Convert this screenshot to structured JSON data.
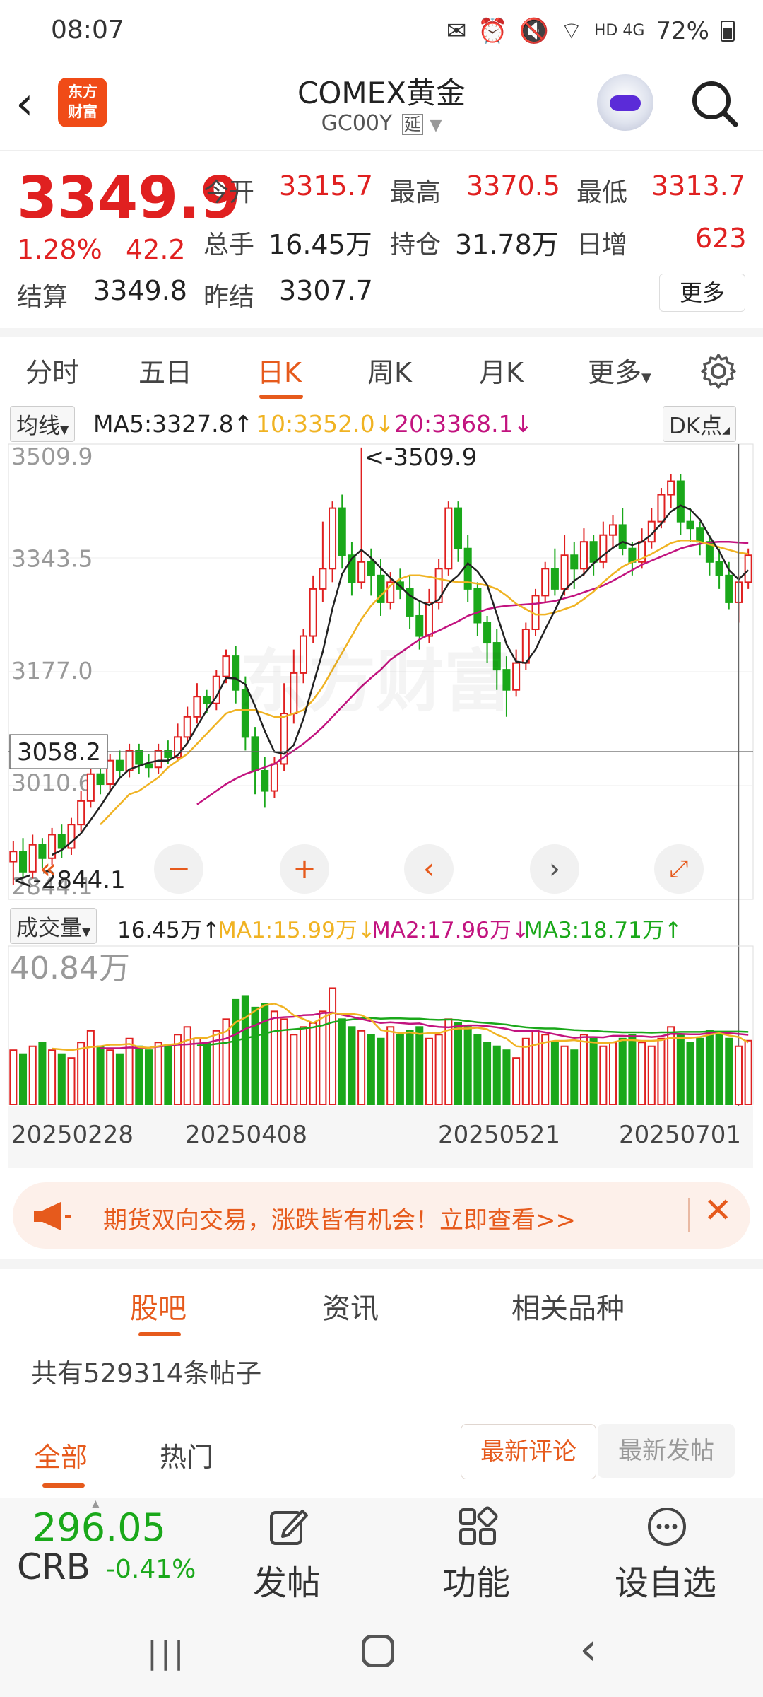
{
  "status_bar": {
    "time": "08:07",
    "icons": "signal-icons",
    "network": "HD 4G",
    "battery": "72%"
  },
  "header": {
    "logo_text": "东方\n财富",
    "title": "COMEX黄金",
    "code": "GC00Y",
    "delay_badge": "延"
  },
  "quote": {
    "price": "3349.9",
    "change_pct": "1.28%",
    "change_val": "42.2",
    "fields": [
      {
        "label": "今开",
        "value": "3315.7"
      },
      {
        "label": "最高",
        "value": "3370.5"
      },
      {
        "label": "最低",
        "value": "3313.7"
      },
      {
        "label": "总手",
        "value": "16.45万"
      },
      {
        "label": "持仓",
        "value": "31.78万"
      },
      {
        "label": "日增",
        "value": "623"
      },
      {
        "label": "结算",
        "value": "3349.8"
      },
      {
        "label": "昨结",
        "value": "3307.7"
      }
    ],
    "more_label": "更多"
  },
  "tabs": [
    "分时",
    "五日",
    "日K",
    "周K",
    "月K",
    "更多"
  ],
  "chart": {
    "ma_button": "均线",
    "ma5": "MA5:3327.8",
    "ma10": "10:3352.0",
    "ma20": "20:3368.1",
    "dk_button": "DK点",
    "y_labels": [
      "3509.9",
      "3343.5",
      "3177.0",
      "3010.6",
      "2844.1"
    ],
    "cursor_label": "3058.2",
    "high_label": "<-3509.9",
    "low_label": "<-2844.1",
    "watermark": "东方财富",
    "vol_button": "成交量",
    "vol_value": "16.45万",
    "vol_ma1": "MA1:15.99万",
    "vol_ma2": "MA2:17.96万",
    "vol_ma3": "MA3:18.71万",
    "vol_max": "40.84万",
    "x_labels": [
      "20250228",
      "20250408",
      "20250521",
      "20250701"
    ],
    "colors": {
      "up": "#e02020",
      "down": "#1aa81a",
      "ma5": "#222222",
      "ma10": "#f0b323",
      "ma20": "#c2137f",
      "vol_ma3": "#1aa81a"
    }
  },
  "chart_data": {
    "type": "candlestick",
    "title": "COMEX黄金 日K",
    "y_range": [
      2844.1,
      3509.9
    ],
    "candles": [
      [
        2895,
        2910,
        2860,
        2925
      ],
      [
        2910,
        2880,
        2870,
        2930
      ],
      [
        2880,
        2920,
        2870,
        2935
      ],
      [
        2920,
        2900,
        2885,
        2930
      ],
      [
        2900,
        2935,
        2890,
        2945
      ],
      [
        2935,
        2915,
        2900,
        2950
      ],
      [
        2915,
        2950,
        2905,
        2960
      ],
      [
        2950,
        2985,
        2940,
        3000
      ],
      [
        2985,
        3025,
        2975,
        3035
      ],
      [
        3025,
        3010,
        2995,
        3045
      ],
      [
        3010,
        3045,
        3000,
        3055
      ],
      [
        3045,
        3030,
        3020,
        3060
      ],
      [
        3030,
        3060,
        3020,
        3070
      ],
      [
        3060,
        3040,
        3025,
        3070
      ],
      [
        3040,
        3035,
        3020,
        3055
      ],
      [
        3035,
        3060,
        3025,
        3070
      ],
      [
        3060,
        3050,
        3040,
        3075
      ],
      [
        3050,
        3080,
        3045,
        3100
      ],
      [
        3080,
        3110,
        3070,
        3125
      ],
      [
        3110,
        3140,
        3100,
        3160
      ],
      [
        3140,
        3130,
        3115,
        3150
      ],
      [
        3130,
        3170,
        3120,
        3180
      ],
      [
        3170,
        3200,
        3160,
        3210
      ],
      [
        3200,
        3150,
        3130,
        3215
      ],
      [
        3150,
        3080,
        3060,
        3170
      ],
      [
        3080,
        3030,
        2995,
        3095
      ],
      [
        3030,
        3000,
        2975,
        3050
      ],
      [
        3000,
        3040,
        2990,
        3050
      ],
      [
        3040,
        3115,
        3030,
        3160
      ],
      [
        3115,
        3175,
        3100,
        3210
      ],
      [
        3175,
        3230,
        3160,
        3240
      ],
      [
        3230,
        3300,
        3220,
        3320
      ],
      [
        3300,
        3330,
        3280,
        3400
      ],
      [
        3330,
        3420,
        3310,
        3430
      ],
      [
        3420,
        3350,
        3330,
        3440
      ],
      [
        3350,
        3310,
        3290,
        3370
      ],
      [
        3310,
        3340,
        3300,
        3510
      ],
      [
        3340,
        3320,
        3290,
        3360
      ],
      [
        3320,
        3280,
        3260,
        3345
      ],
      [
        3280,
        3310,
        3270,
        3325
      ],
      [
        3310,
        3300,
        3285,
        3330
      ],
      [
        3300,
        3260,
        3240,
        3320
      ],
      [
        3260,
        3230,
        3210,
        3280
      ],
      [
        3230,
        3280,
        3220,
        3300
      ],
      [
        3280,
        3330,
        3270,
        3345
      ],
      [
        3330,
        3420,
        3320,
        3430
      ],
      [
        3420,
        3360,
        3340,
        3430
      ],
      [
        3360,
        3300,
        3280,
        3380
      ],
      [
        3300,
        3250,
        3230,
        3310
      ],
      [
        3250,
        3220,
        3190,
        3260
      ],
      [
        3220,
        3180,
        3150,
        3240
      ],
      [
        3180,
        3150,
        3110,
        3200
      ],
      [
        3150,
        3190,
        3140,
        3210
      ],
      [
        3190,
        3240,
        3180,
        3250
      ],
      [
        3240,
        3290,
        3230,
        3300
      ],
      [
        3290,
        3330,
        3280,
        3340
      ],
      [
        3330,
        3300,
        3290,
        3360
      ],
      [
        3300,
        3350,
        3290,
        3380
      ],
      [
        3350,
        3330,
        3300,
        3370
      ],
      [
        3330,
        3370,
        3320,
        3390
      ],
      [
        3370,
        3340,
        3320,
        3380
      ],
      [
        3340,
        3380,
        3330,
        3400
      ],
      [
        3380,
        3395,
        3360,
        3410
      ],
      [
        3395,
        3360,
        3350,
        3420
      ],
      [
        3360,
        3340,
        3320,
        3370
      ],
      [
        3340,
        3370,
        3330,
        3390
      ],
      [
        3370,
        3400,
        3360,
        3420
      ],
      [
        3400,
        3440,
        3390,
        3450
      ],
      [
        3440,
        3460,
        3420,
        3470
      ],
      [
        3460,
        3400,
        3380,
        3470
      ],
      [
        3400,
        3390,
        3370,
        3420
      ],
      [
        3390,
        3370,
        3350,
        3400
      ],
      [
        3370,
        3340,
        3320,
        3380
      ],
      [
        3340,
        3320,
        3300,
        3360
      ],
      [
        3320,
        3280,
        3270,
        3340
      ],
      [
        3280,
        3310,
        3250,
        3320
      ],
      [
        3310,
        3350,
        3300,
        3360
      ]
    ],
    "ma5": [
      null,
      null,
      null,
      null,
      2905,
      2912,
      2924,
      2937,
      2957,
      2977,
      2999,
      3019,
      3032,
      3037,
      3042,
      3045,
      3045,
      3053,
      3071,
      3096,
      3120,
      3140,
      3168,
      3167,
      3158,
      3126,
      3089,
      3058,
      3055,
      3068,
      3107,
      3158,
      3207,
      3271,
      3322,
      3345,
      3358,
      3346,
      3331,
      3316,
      3304,
      3290,
      3282,
      3276,
      3284,
      3308,
      3320,
      3338,
      3326,
      3306,
      3262,
      3218,
      3192,
      3190,
      3210,
      3240,
      3268,
      3298,
      3312,
      3322,
      3338,
      3350,
      3361,
      3370,
      3365,
      3370,
      3381,
      3397,
      3415,
      3424,
      3418,
      3403,
      3378,
      3356,
      3328,
      3314,
      3327.8
    ],
    "ma10": [
      null,
      null,
      null,
      null,
      null,
      null,
      null,
      null,
      null,
      2950,
      2965,
      2980,
      2995,
      3000,
      3010,
      3020,
      3035,
      3045,
      3055,
      3070,
      3085,
      3100,
      3115,
      3120,
      3120,
      3120,
      3115,
      3110,
      3110,
      3115,
      3120,
      3135,
      3155,
      3180,
      3205,
      3230,
      3255,
      3275,
      3290,
      3305,
      3315,
      3320,
      3320,
      3318,
      3315,
      3312,
      3310,
      3310,
      3308,
      3305,
      3300,
      3290,
      3278,
      3270,
      3262,
      3262,
      3265,
      3270,
      3275,
      3285,
      3296,
      3310,
      3322,
      3333,
      3340,
      3345,
      3352,
      3360,
      3368,
      3372,
      3372,
      3370,
      3366,
      3362,
      3358,
      3354,
      3352.0
    ],
    "ma20": [
      null,
      null,
      null,
      null,
      null,
      null,
      null,
      null,
      null,
      null,
      null,
      null,
      null,
      null,
      null,
      null,
      null,
      null,
      null,
      2980,
      2990,
      3000,
      3010,
      3018,
      3025,
      3030,
      3035,
      3040,
      3050,
      3060,
      3070,
      3082,
      3095,
      3110,
      3125,
      3140,
      3155,
      3168,
      3180,
      3195,
      3205,
      3215,
      3225,
      3232,
      3238,
      3245,
      3252,
      3260,
      3265,
      3270,
      3273,
      3275,
      3276,
      3277,
      3278,
      3280,
      3282,
      3286,
      3290,
      3295,
      3300,
      3305,
      3312,
      3320,
      3328,
      3336,
      3342,
      3348,
      3354,
      3360,
      3364,
      3367,
      3369,
      3370,
      3370,
      3369,
      3368.1
    ],
    "volume_range": [
      0,
      40.84
    ],
    "volume": [
      14,
      13,
      15,
      16,
      14,
      13,
      12,
      16,
      19,
      15,
      14,
      13,
      17,
      15,
      14,
      16,
      15,
      18,
      20,
      17,
      16,
      19,
      22,
      27,
      28,
      25,
      26,
      24,
      22,
      18,
      20,
      21,
      24,
      30,
      22,
      20,
      19,
      18,
      17,
      20,
      18,
      19,
      20,
      17,
      18,
      22,
      21,
      20,
      18,
      16,
      15,
      14,
      12,
      17,
      19,
      18,
      16,
      15,
      14,
      18,
      17,
      15,
      16,
      17,
      18,
      16,
      15,
      17,
      20,
      18,
      16,
      17,
      19,
      18,
      17,
      15,
      16.45
    ],
    "vol_ma1": [
      null,
      null,
      null,
      null,
      14.4,
      14.2,
      14,
      14.4,
      14.8,
      15,
      15.4,
      15.4,
      15.6,
      14.8,
      14.6,
      15,
      15.4,
      15.6,
      16.6,
      17.2,
      17.2,
      18,
      18.8,
      21.2,
      22.4,
      24.2,
      25.6,
      26,
      25,
      23,
      22,
      21,
      22.4,
      23.6,
      23.4,
      23.4,
      23,
      21.8,
      19.2,
      18.8,
      18.4,
      18.6,
      18.2,
      18.4,
      18.4,
      19.2,
      19.6,
      19.6,
      19.8,
      19.4,
      18,
      17,
      15,
      14.8,
      15.4,
      16,
      16.4,
      16.4,
      16.6,
      16.2,
      16,
      15.8,
      16,
      16.6,
      16.6,
      16.4,
      16.4,
      16.6,
      17.2,
      17.2,
      17.2,
      17.4,
      18,
      18.4,
      17.8,
      17.4,
      15.99
    ],
    "vol_ma2": [
      null,
      null,
      null,
      null,
      null,
      null,
      null,
      null,
      null,
      14.5,
      14.5,
      14.5,
      14.7,
      14.6,
      14.6,
      14.9,
      15.2,
      15.4,
      15.5,
      15.7,
      15.9,
      16.5,
      17,
      18.1,
      19.5,
      20.4,
      21.5,
      22.3,
      22.5,
      22.6,
      23,
      23.1,
      23.6,
      23.7,
      23.1,
      22.6,
      22,
      21.5,
      21,
      21.2,
      21,
      20.8,
      20.9,
      20.3,
      20,
      19.9,
      20.2,
      20.4,
      20.4,
      20.2,
      19.9,
      19.5,
      18.9,
      18.9,
      19,
      18.6,
      18.1,
      17.6,
      17.2,
      17.4,
      17.4,
      17.3,
      17.7,
      17.7,
      17.6,
      17.6,
      17.4,
      17.6,
      18.2,
      18.2,
      18.1,
      18.1,
      18.4,
      18.4,
      18.4,
      18.2,
      17.96
    ],
    "vol_ma3": [
      null,
      null,
      null,
      null,
      null,
      null,
      null,
      null,
      null,
      null,
      null,
      null,
      null,
      null,
      null,
      null,
      null,
      null,
      null,
      15.2,
      15.3,
      15.6,
      15.9,
      16.4,
      17.1,
      17.6,
      18.3,
      18.9,
      19.2,
      19.4,
      19.6,
      19.9,
      20.4,
      21.2,
      21.6,
      21.9,
      22.2,
      22.3,
      22.1,
      22.2,
      22.2,
      22.1,
      22.1,
      21.9,
      21.8,
      21.9,
      21.8,
      21.5,
      21.2,
      21,
      20.8,
      20.6,
      20.2,
      19.9,
      19.7,
      19.6,
      19.6,
      19.4,
      19.2,
      19.1,
      19,
      18.8,
      18.7,
      18.6,
      18.6,
      18.6,
      18.5,
      18.6,
      18.6,
      18.7,
      18.7,
      18.7,
      18.8,
      18.8,
      18.8,
      18.8,
      18.71
    ],
    "x_ticks": [
      "20250228",
      "20250408",
      "20250521",
      "20250701"
    ]
  },
  "banner": {
    "text": "期货双向交易，涨跌皆有机会！立即查看>>"
  },
  "subtabs": [
    "股吧",
    "资讯",
    "相关品种"
  ],
  "posts": {
    "count_text": "共有529314条帖子"
  },
  "filter_tabs": [
    "全部",
    "热门"
  ],
  "sort_buttons": [
    "最新评论",
    "最新发帖"
  ],
  "bottom": {
    "crb_value": "296.05",
    "crb_label": "CRB",
    "crb_change": "-0.41%",
    "actions": [
      "发帖",
      "功能",
      "设自选"
    ]
  }
}
